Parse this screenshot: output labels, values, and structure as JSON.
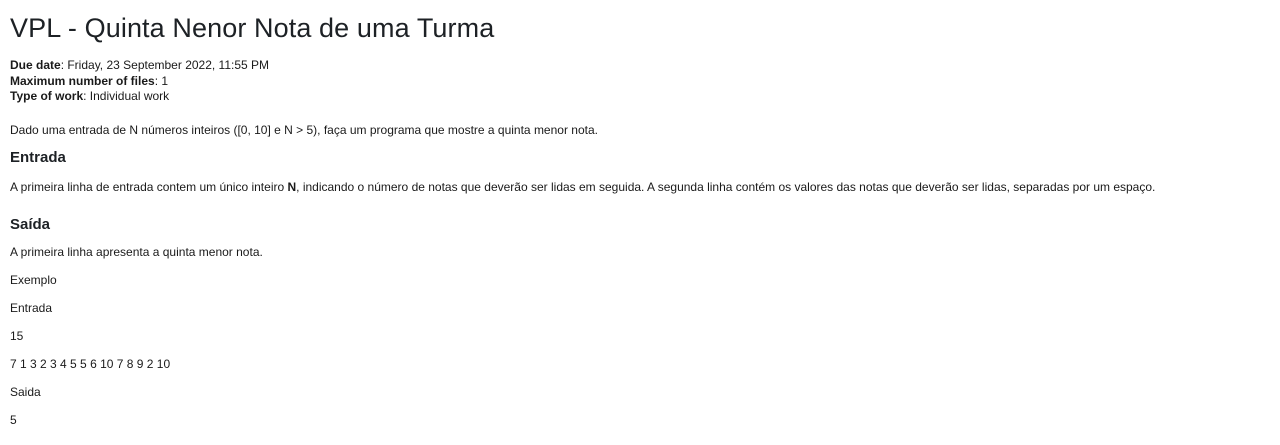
{
  "title": "VPL - Quinta Nenor Nota de uma Turma",
  "meta": {
    "due_date_label": "Due date",
    "due_date_value": ": Friday, 23 September 2022, 11:55 PM",
    "max_files_label": "Maximum number of files",
    "max_files_value": ": 1",
    "work_type_label": "Type of work",
    "work_type_value": ": Individual work"
  },
  "description": {
    "intro": "Dado uma entrada de N números inteiros ([0, 10] e N > 5), faça um programa que mostre a quinta menor nota.",
    "entrada_heading": "Entrada",
    "entrada_text_before": "A primeira linha de entrada contem um único inteiro ",
    "entrada_text_bold": "N",
    "entrada_text_after": ", indicando o número de notas que deverão ser lidas em seguida. A segunda linha contém os valores das notas que deverão ser lidas, separadas por um espaço.",
    "saida_heading": "Saída",
    "saida_text": "A primeira linha apresenta a quinta menor nota.",
    "exemplo_label": "Exemplo",
    "exemplo_entrada_label": "Entrada",
    "exemplo_entrada_line1": "15",
    "exemplo_entrada_line2": "7 1 3 2 3 4 5 5 6 10 7 8 9 2 10",
    "exemplo_saida_label": "Saida",
    "exemplo_saida_value": "5"
  }
}
